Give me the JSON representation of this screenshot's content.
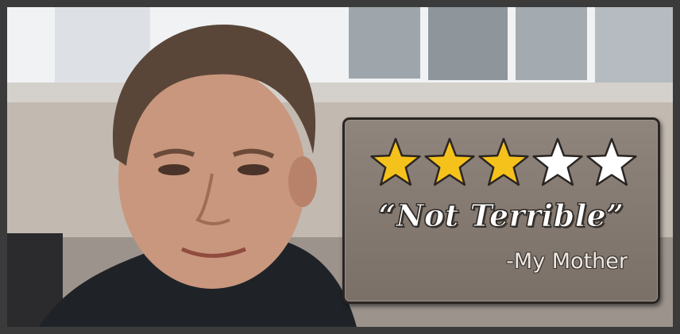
{
  "review": {
    "rating": 3,
    "max_rating": 5,
    "quote": "“Not Terrible”",
    "attribution": "-My Mother"
  },
  "colors": {
    "star_filled": "#f5c21b",
    "star_empty": "#ffffff",
    "card_background": "#857b73"
  }
}
